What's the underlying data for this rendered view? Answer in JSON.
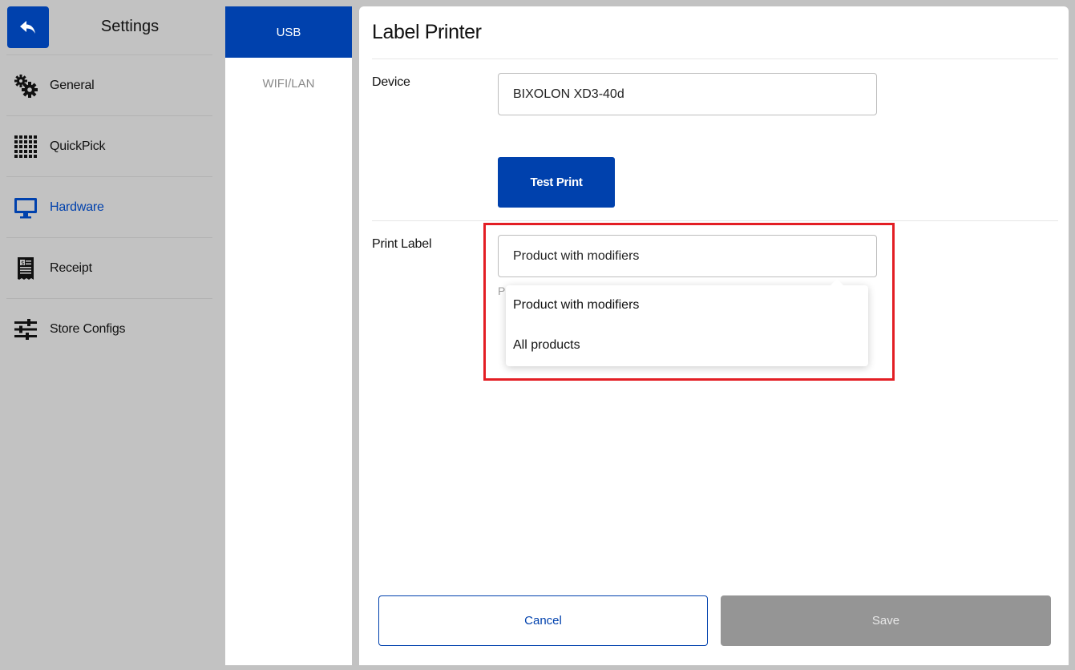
{
  "sidebar": {
    "title": "Settings",
    "items": [
      {
        "label": "General",
        "icon": "gears-icon"
      },
      {
        "label": "QuickPick",
        "icon": "grid-icon"
      },
      {
        "label": "Hardware",
        "icon": "monitor-icon",
        "active": true
      },
      {
        "label": "Receipt",
        "icon": "receipt-icon"
      },
      {
        "label": "Store Configs",
        "icon": "sliders-icon"
      }
    ]
  },
  "tabs": [
    {
      "label": "USB",
      "active": true
    },
    {
      "label": "WIFI/LAN"
    }
  ],
  "main": {
    "title": "Label Printer",
    "device": {
      "label": "Device",
      "value": "BIXOLON XD3-40d"
    },
    "test_print_label": "Test Print",
    "print_label": {
      "label": "Print Label",
      "value": "Product with modifiers",
      "hint": "P",
      "options": [
        "Product with modifiers",
        "All products"
      ]
    },
    "cancel_label": "Cancel",
    "save_label": "Save"
  },
  "colors": {
    "accent": "#0041ad",
    "highlight": "#e31e24",
    "disabled": "#959595"
  }
}
